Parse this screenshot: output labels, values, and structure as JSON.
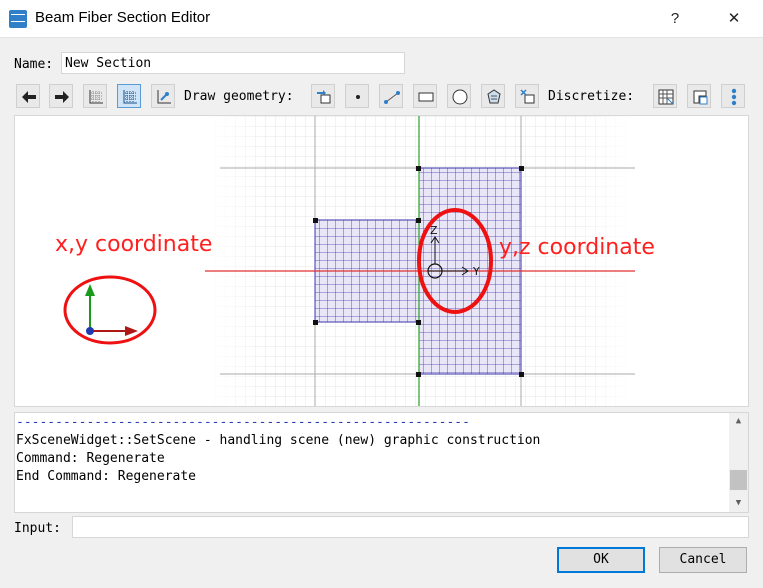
{
  "window": {
    "title": "Beam Fiber Section Editor",
    "help_label": "?",
    "close_label": "✕"
  },
  "name_row": {
    "label": "Name:",
    "value": "New Section"
  },
  "toolbar": {
    "draw_label": "Draw geometry:",
    "discretize_label": "Discretize:"
  },
  "annotations": {
    "left_text": "x,y coordinate",
    "right_text": "y,z coordinate",
    "color": "#ff2020"
  },
  "axes": {
    "z_label": "Z",
    "y_label": "Y"
  },
  "log": {
    "lines": [
      "----------------------------------------------------------",
      "FxSceneWidget::SetScene - handling scene (new) graphic construction",
      "Command: Regenerate",
      "End Command: Regenerate"
    ]
  },
  "input": {
    "label": "Input:",
    "value": ""
  },
  "buttons": {
    "ok": "OK",
    "cancel": "Cancel"
  },
  "colors": {
    "grid_fill": "#e9e6f7",
    "grid_line": "#3a34a8",
    "axis_red": "#e03030",
    "axis_green": "#2aa02a"
  }
}
